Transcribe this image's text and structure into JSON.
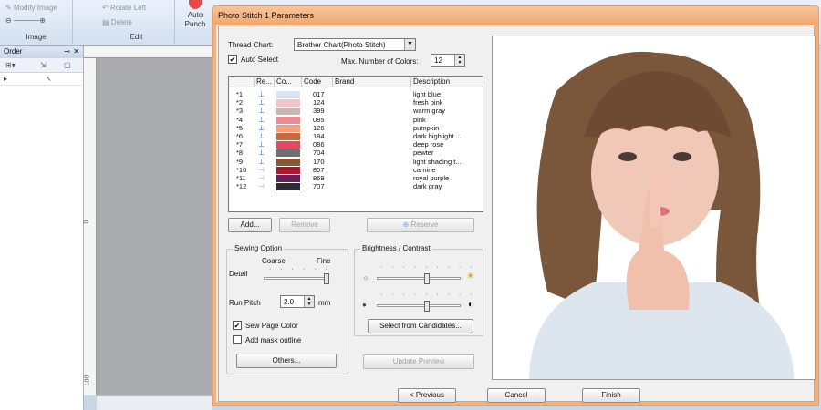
{
  "app": {
    "ribbon": {
      "modify_image": "Modify Image",
      "image_label": "Image",
      "rotate_left": "Rotate Left",
      "delete": "Delete",
      "edit_label": "Edit",
      "auto_punch": "Auto Punch"
    },
    "order_panel": {
      "title": "Order"
    },
    "ruler": {
      "left_top": "0",
      "left_bottom": "100"
    }
  },
  "dialog": {
    "title": "Photo Stitch 1 Parameters",
    "thread_chart_label": "Thread Chart:",
    "thread_chart_value": "Brother Chart(Photo Stitch)",
    "auto_select_label": "Auto Select",
    "auto_select_checked": true,
    "max_colors_label": "Max. Number of Colors:",
    "max_colors_value": "12",
    "columns": [
      "Re...",
      "Co...",
      "Code",
      "Brand",
      "Description"
    ],
    "threads": [
      {
        "idx": "*1",
        "code": "017",
        "desc": "light blue",
        "color": "#dbe6f2"
      },
      {
        "idx": "*2",
        "code": "124",
        "desc": "fresh pink",
        "color": "#f2c5c8"
      },
      {
        "idx": "*3",
        "code": "399",
        "desc": "warm gray",
        "color": "#c9b7b4"
      },
      {
        "idx": "*4",
        "code": "085",
        "desc": "pink",
        "color": "#ef8a99"
      },
      {
        "idx": "*5",
        "code": "126",
        "desc": "pumpkin",
        "color": "#f0a07d"
      },
      {
        "idx": "*6",
        "code": "184",
        "desc": "dark highlight ...",
        "color": "#c8693f"
      },
      {
        "idx": "*7",
        "code": "086",
        "desc": "deep rose",
        "color": "#e44a5e"
      },
      {
        "idx": "*8",
        "code": "704",
        "desc": "pewter",
        "color": "#6e6f73"
      },
      {
        "idx": "*9",
        "code": "170",
        "desc": "light shading t...",
        "color": "#8a5533"
      },
      {
        "idx": "*10",
        "code": "807",
        "desc": "carnine",
        "color": "#a81a2e"
      },
      {
        "idx": "*11",
        "code": "869",
        "desc": "royal purple",
        "color": "#6a1d5a"
      },
      {
        "idx": "*12",
        "code": "707",
        "desc": "dark gray",
        "color": "#2c2c38"
      }
    ],
    "add_button": "Add...",
    "remove_button": "Remove",
    "reserve_button": "Reserve",
    "sewing_option": {
      "title": "Sewing Option",
      "coarse": "Coarse",
      "fine": "Fine",
      "detail_label": "Detail",
      "detail_level": 1.0,
      "run_pitch_label": "Run Pitch",
      "run_pitch_value": "2.0",
      "run_pitch_unit": "mm",
      "sew_page_color": "Sew Page Color",
      "sew_page_color_checked": true,
      "add_mask_outline": "Add mask outline",
      "add_mask_outline_checked": false,
      "others_button": "Others..."
    },
    "brightness_contrast": {
      "title": "Brightness / Contrast",
      "brightness_level": 0.6,
      "contrast_level": 0.6,
      "select_candidates_button": "Select from Candidates..."
    },
    "update_preview_button": "Update Preview",
    "previous_button": "< Previous",
    "cancel_button": "Cancel",
    "finish_button": "Finish"
  }
}
